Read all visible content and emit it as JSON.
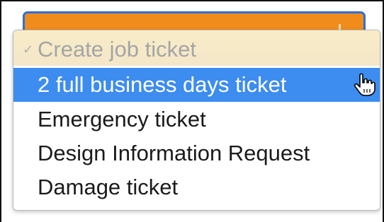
{
  "select": {
    "selected_value": "Create job ticket",
    "accent_color": "#f08c1c",
    "focus_color": "#2f6fd8"
  },
  "menu": {
    "items": [
      {
        "label": "Create job ticket",
        "state": "current-disabled",
        "icon": "checkmark-icon"
      },
      {
        "label": "2 full business days ticket",
        "state": "highlighted"
      },
      {
        "label": "Emergency ticket",
        "state": "normal"
      },
      {
        "label": "Design Information Request",
        "state": "normal"
      },
      {
        "label": "Damage ticket",
        "state": "normal"
      }
    ],
    "highlight_color": "#3d8cf0",
    "check_glyph": "✓"
  },
  "pointer": {
    "icon": "hand-pointer-icon"
  }
}
